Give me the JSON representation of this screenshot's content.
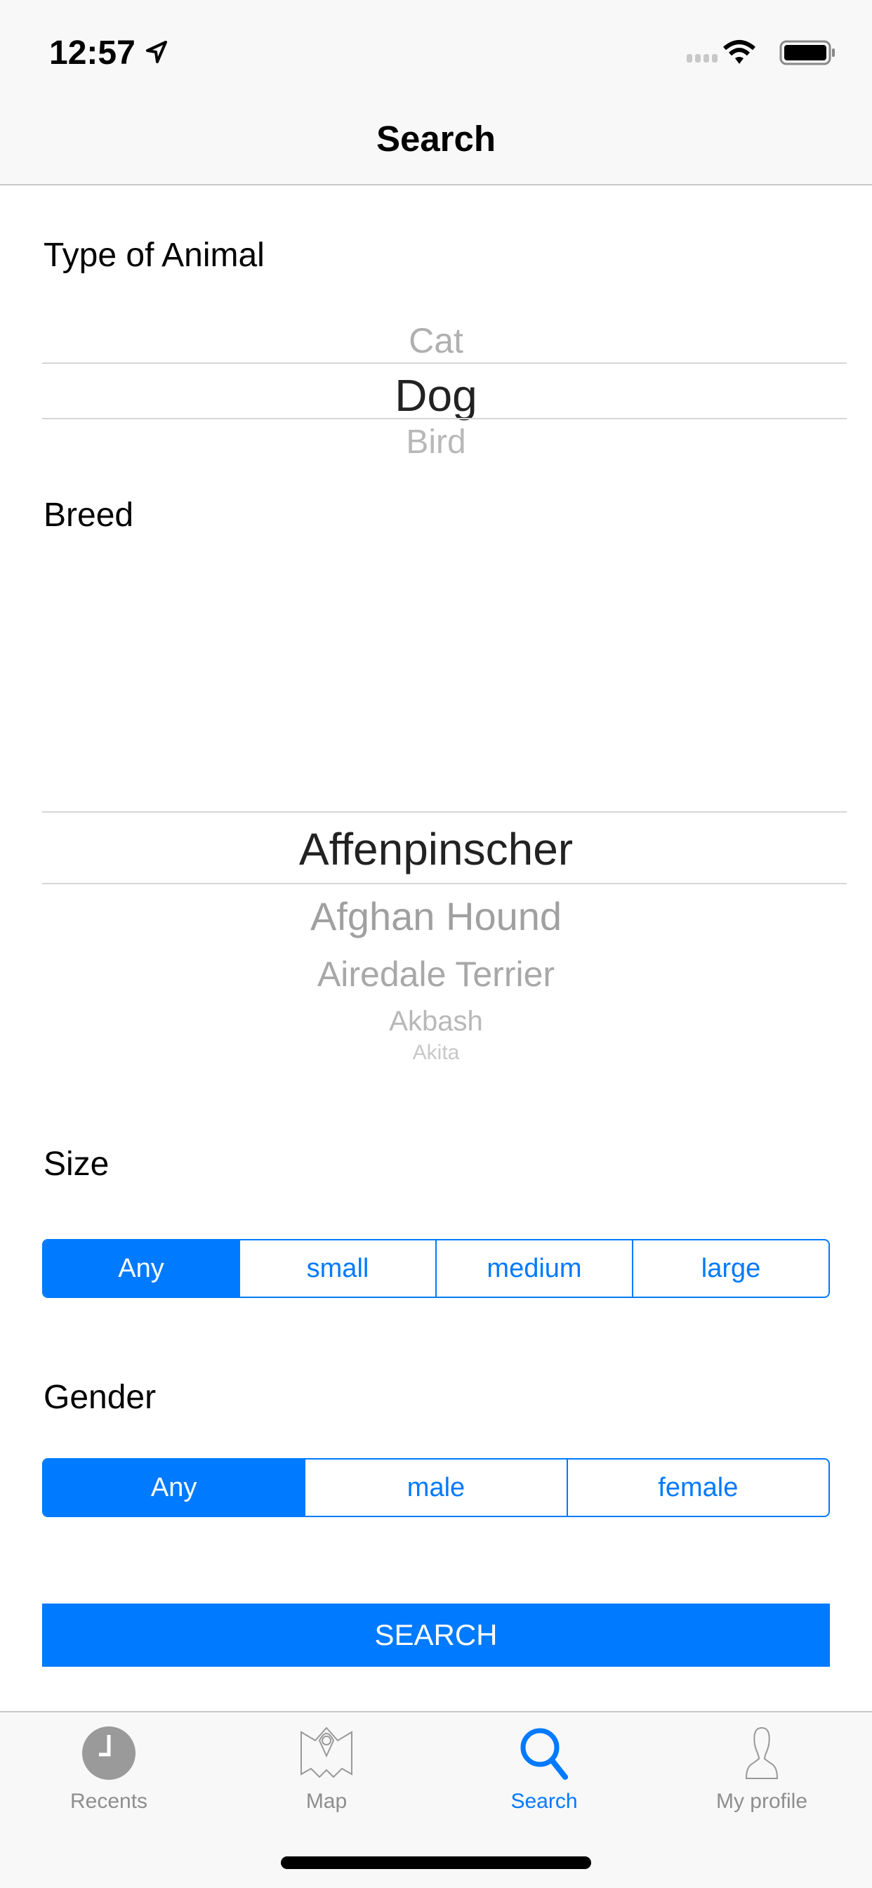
{
  "status_bar": {
    "time": "12:57"
  },
  "nav": {
    "title": "Search"
  },
  "animal": {
    "label": "Type of Animal",
    "options": [
      "Cat",
      "Dog",
      "Bird"
    ],
    "selected": "Dog"
  },
  "breed": {
    "label": "Breed",
    "options": [
      "Affenpinscher",
      "Afghan Hound",
      "Airedale Terrier",
      "Akbash",
      "Akita"
    ],
    "selected": "Affenpinscher"
  },
  "size": {
    "label": "Size",
    "options": [
      "Any",
      "small",
      "medium",
      "large"
    ],
    "selected": "Any"
  },
  "gender": {
    "label": "Gender",
    "options": [
      "Any",
      "male",
      "female"
    ],
    "selected": "Any"
  },
  "search_button": "SEARCH",
  "tabs": [
    {
      "label": "Recents",
      "icon": "clock-icon"
    },
    {
      "label": "Map",
      "icon": "map-icon"
    },
    {
      "label": "Search",
      "icon": "search-icon"
    },
    {
      "label": "My profile",
      "icon": "profile-icon"
    }
  ],
  "colors": {
    "accent": "#007aff"
  }
}
